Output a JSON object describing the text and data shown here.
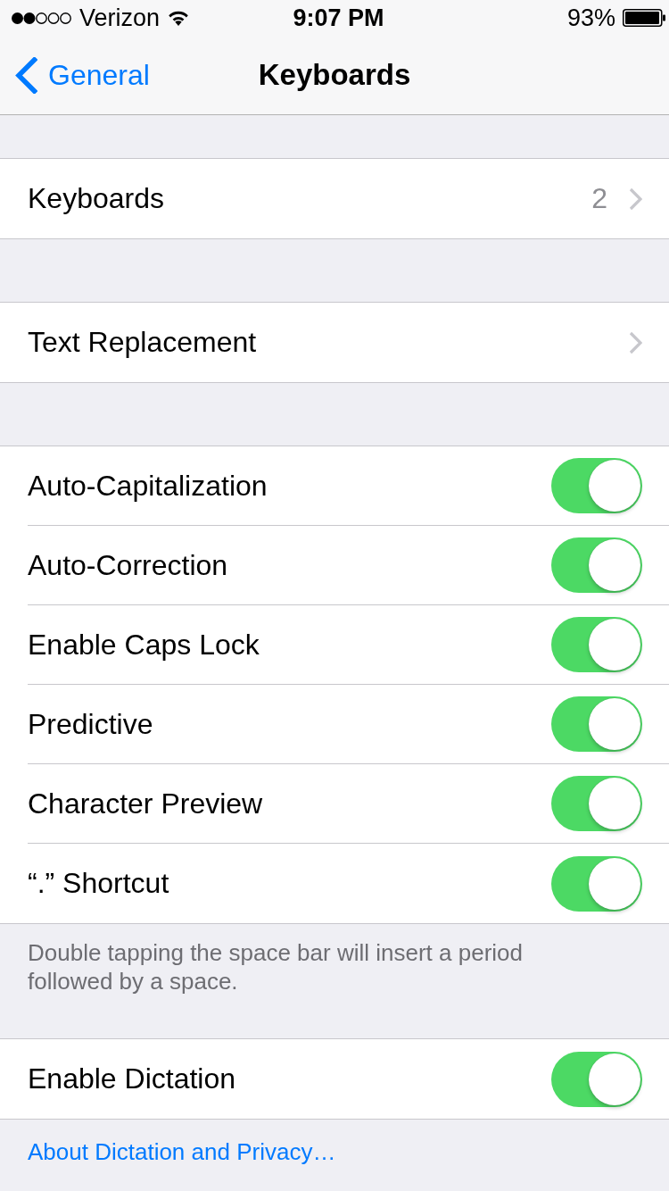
{
  "status_bar": {
    "carrier": "Verizon",
    "time": "9:07 PM",
    "battery": "93%"
  },
  "nav": {
    "back": "General",
    "title": "Keyboards"
  },
  "sections": [
    {
      "rows": [
        {
          "kind": "link",
          "label": "Keyboards",
          "value": "2"
        }
      ]
    },
    {
      "rows": [
        {
          "kind": "link",
          "label": "Text Replacement"
        }
      ]
    },
    {
      "rows": [
        {
          "kind": "toggle",
          "label": "Auto-Capitalization",
          "on": true
        },
        {
          "kind": "toggle",
          "label": "Auto-Correction",
          "on": true
        },
        {
          "kind": "toggle",
          "label": "Enable Caps Lock",
          "on": true
        },
        {
          "kind": "toggle",
          "label": "Predictive",
          "on": true
        },
        {
          "kind": "toggle",
          "label": "Character Preview",
          "on": true
        },
        {
          "kind": "toggle",
          "label": "“.” Shortcut",
          "on": true
        }
      ],
      "footer": {
        "kind": "note",
        "text": "Double tapping the space bar will insert a period followed by a space."
      }
    },
    {
      "rows": [
        {
          "kind": "toggle",
          "label": "Enable Dictation",
          "on": true
        }
      ],
      "footer": {
        "kind": "link",
        "text": "About Dictation and Privacy…"
      }
    }
  ]
}
